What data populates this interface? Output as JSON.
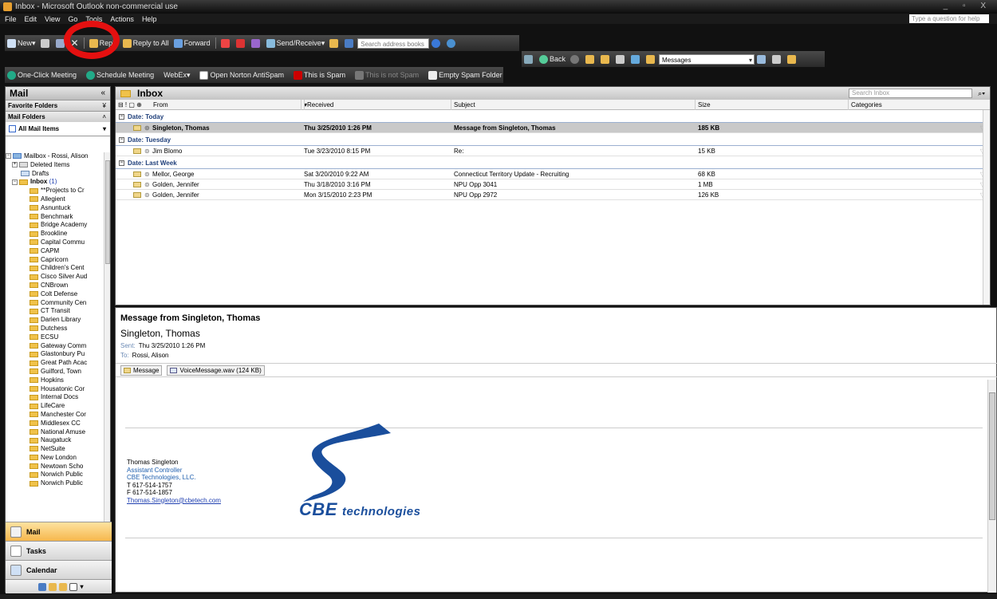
{
  "window": {
    "title": "Inbox - Microsoft Outlook non-commercial use"
  },
  "menu": {
    "items": [
      "File",
      "Edit",
      "View",
      "Go",
      "Tools",
      "Actions",
      "Help"
    ],
    "help_box": "Type a question for help"
  },
  "toolbar1": {
    "new": "New",
    "reply": "Reply",
    "reply_all": "Reply to All",
    "forward": "Forward",
    "send_receive": "Send/Receive",
    "search_address": "Search address books"
  },
  "toolbar2": {
    "back": "Back",
    "messages": "Messages"
  },
  "toolbar3": {
    "one_click": "One-Click Meeting",
    "schedule": "Schedule Meeting",
    "webex": "WebEx",
    "norton": "Open Norton AntiSpam",
    "spam": "This is Spam",
    "not_spam": "This is not Spam",
    "empty_spam": "Empty Spam Folder"
  },
  "nav": {
    "title": "Mail",
    "favorite": "Favorite Folders",
    "mail_folders": "Mail Folders",
    "all_items": "All Mail Items",
    "mailbox": "Mailbox - Rossi, Alison",
    "deleted": "Deleted Items",
    "drafts": "Drafts",
    "inbox": "Inbox",
    "inbox_count": "(1)",
    "folders": [
      "**Projects to Cr",
      "Allegient",
      "Asnuntuck",
      "Benchmark",
      "Bridge Academy",
      "Brookline",
      "Capital Commu",
      "CAPM",
      "Capricorn",
      "Children's Cent",
      "Cisco Silver Aud",
      "CNBrown",
      "Colt Defense",
      "Community Cen",
      "CT Transit",
      "Darien Library",
      "Dutchess",
      "ECSU",
      "Gateway Comm",
      "Glastonbury Pu",
      "Great Path Acac",
      "Guilford, Town",
      "Hopkins",
      "Housatonic Cor",
      "Internal Docs",
      "LifeCare",
      "Manchester Cor",
      "Middlesex CC",
      "National Amuse",
      "Naugatuck",
      "NetSuite",
      "New London",
      "Newtown Scho",
      "Norwich Public",
      "Norwich Public"
    ],
    "buttons": {
      "mail": "Mail",
      "tasks": "Tasks",
      "calendar": "Calendar"
    }
  },
  "inbox": {
    "title": "Inbox",
    "search_placeholder": "Search Inbox",
    "columns": {
      "from": "From",
      "received": "Received",
      "subject": "Subject",
      "size": "Size",
      "categories": "Categories"
    },
    "groups": [
      {
        "label": "Date: Today",
        "messages": [
          {
            "from": "Singleton, Thomas",
            "received": "Thu 3/25/2010 1:26 PM",
            "subject": "Message from Singleton, Thomas",
            "size": "185 KB"
          }
        ]
      },
      {
        "label": "Date: Tuesday",
        "messages": [
          {
            "from": "Jim Blomo",
            "received": "Tue 3/23/2010 8:15 PM",
            "subject": "Re:",
            "size": "15 KB"
          }
        ]
      },
      {
        "label": "Date: Last Week",
        "messages": [
          {
            "from": "Mellor, George",
            "received": "Sat 3/20/2010 9:22 AM",
            "subject": "Connecticut Territory Update - Recruiting",
            "size": "68 KB"
          },
          {
            "from": "Golden, Jennifer",
            "received": "Thu 3/18/2010 3:16 PM",
            "subject": "NPU Opp 3041",
            "size": "1 MB"
          },
          {
            "from": "Golden, Jennifer",
            "received": "Mon 3/15/2010 2:23 PM",
            "subject": "NPU Opp 2972",
            "size": "126 KB"
          }
        ]
      }
    ]
  },
  "reading": {
    "subject": "Message from Singleton, Thomas",
    "sender": "Singleton, Thomas",
    "sent_label": "Sent:",
    "sent": "Thu 3/25/2010 1:26 PM",
    "to_label": "To:",
    "to": "Rossi, Alison",
    "attach_message": "Message",
    "attach_file": "VoiceMessage.wav (124 KB)",
    "signature": {
      "name": "Thomas Singleton",
      "title": "Assistant Controller",
      "company": "CBE Technologies, LLC.",
      "phone": "T   617-514-1757",
      "fax": "F   617-514-1857",
      "email": "Thomas.Singleton@cbetech.com"
    },
    "logo": {
      "brand": "CBE",
      "tag": "technologies"
    }
  },
  "colors": {
    "accent": "#1a4e9c",
    "selection": "#c9c9c9",
    "highlight_circle": "#e41010",
    "mail_button": "#f6b74d"
  }
}
